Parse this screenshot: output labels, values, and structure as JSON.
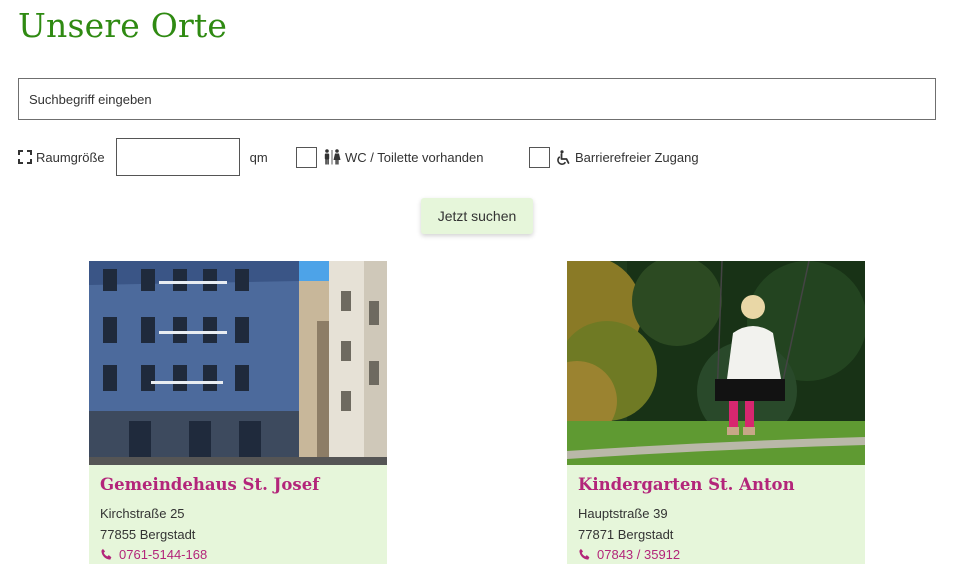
{
  "page": {
    "title": "Unsere Orte"
  },
  "search": {
    "placeholder": "Suchbegriff eingeben"
  },
  "filters": {
    "room_size_label": "Raumgröße",
    "room_size_unit": "qm",
    "wc_label": "WC / Toilette vorhanden",
    "barrier_free_label": "Barrierefreier Zugang"
  },
  "submit": {
    "label": "Jetzt suchen"
  },
  "locations": [
    {
      "name": "Gemeindehaus St. Josef",
      "street": "Kirchstraße 25",
      "city": "77855 Bergstadt",
      "phone": "0761-5144-168"
    },
    {
      "name": "Kindergarten St. Anton",
      "street": "Hauptstraße 39",
      "city": "77871 Bergstadt",
      "phone": "07843 / 35912"
    }
  ],
  "colors": {
    "title_green": "#2f8a12",
    "card_bg": "#e6f6da",
    "accent_magenta": "#b3257a",
    "button_bg": "#e6f6da"
  },
  "icons": {
    "room_size": "expand-corners-icon",
    "wc": "restroom-icon",
    "barrier_free": "wheelchair-icon",
    "phone": "phone-icon"
  }
}
